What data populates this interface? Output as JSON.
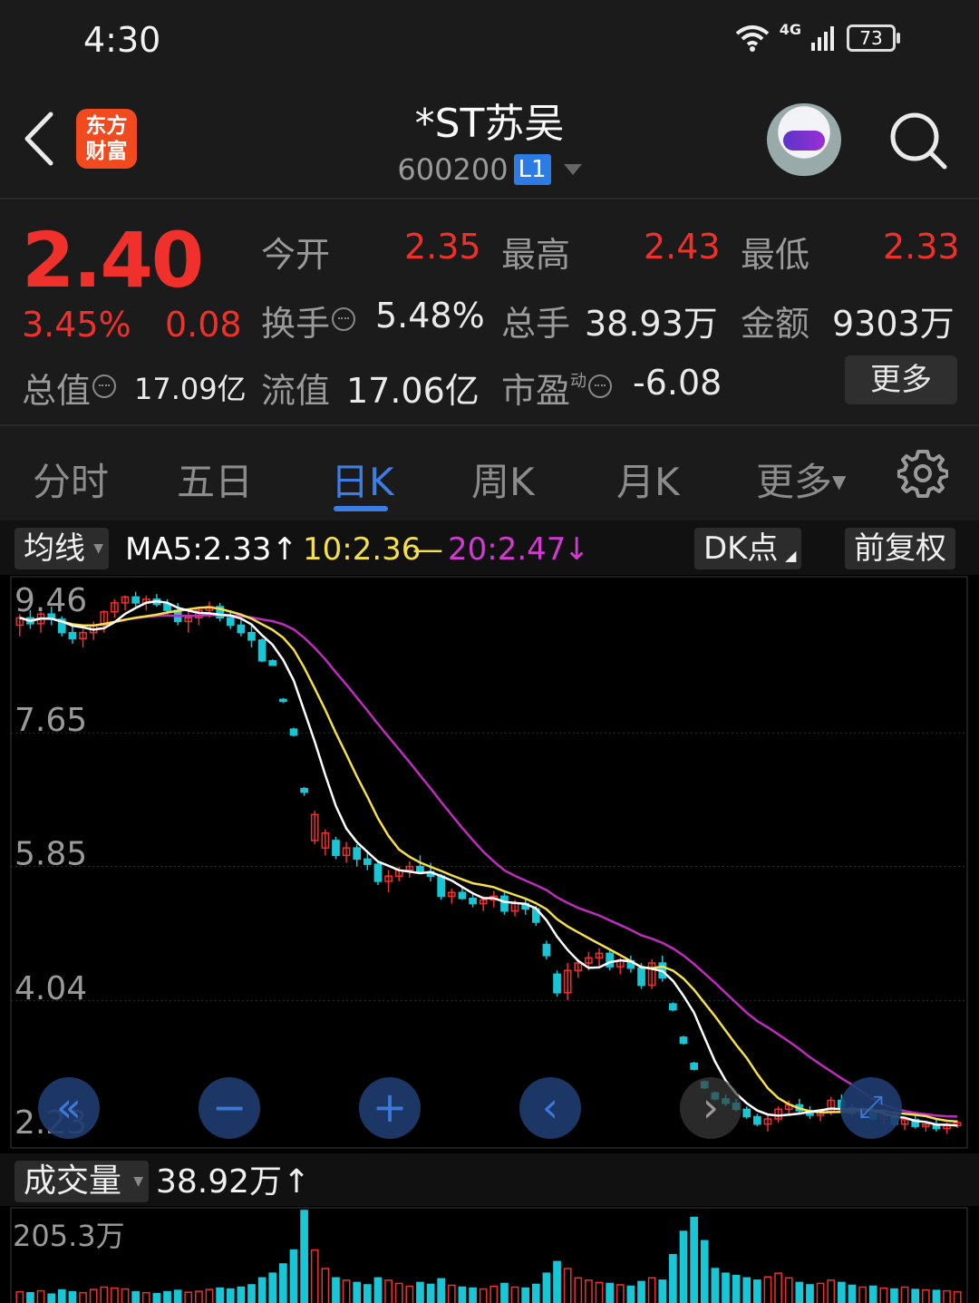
{
  "status_bar": {
    "time": "4:30",
    "network": "4G",
    "battery": "73"
  },
  "header": {
    "app_logo_line1": "东方",
    "app_logo_line2": "财富",
    "stock_name": "*ST苏吴",
    "stock_code": "600200",
    "level_badge": "L1"
  },
  "quote": {
    "price": "2.40",
    "change_pct": "3.45%",
    "change_amt": "0.08",
    "open_label": "今开",
    "open_value": "2.35",
    "high_label": "最高",
    "high_value": "2.43",
    "low_label": "最低",
    "low_value": "2.33",
    "turnover_label": "换手",
    "turnover_value": "5.48%",
    "volume_label": "总手",
    "volume_value": "38.93万",
    "amount_label": "金额",
    "amount_value": "9303万",
    "total_cap_label": "总值",
    "total_cap_value": "17.09亿",
    "float_cap_label": "流值",
    "float_cap_value": "17.06亿",
    "pe_label": "市盈",
    "pe_super": "动",
    "pe_value": "-6.08",
    "more_button": "更多"
  },
  "tabs": [
    {
      "label": "分时"
    },
    {
      "label": "五日"
    },
    {
      "label": "日K"
    },
    {
      "label": "周K"
    },
    {
      "label": "月K"
    },
    {
      "label": "更多"
    }
  ],
  "indicator_row": {
    "ma_chip": "均线",
    "ma5": "MA5:2.33",
    "ma5_arrow": "↑",
    "ma10": "10:2.36",
    "ma10_sep": "—",
    "ma20": "20:2.47",
    "ma20_arrow": "↓",
    "dk_button": "DK点",
    "adjust_button": "前复权"
  },
  "volume_row": {
    "chip": "成交量",
    "value": "38.92万",
    "arrow": "↑",
    "axis_max": "205.3万"
  },
  "colors": {
    "up": "#f0302b",
    "down": "#18c6d6",
    "ma5": "#ffffff",
    "ma10": "#f5e04a",
    "ma20": "#c22bc2",
    "accent": "#3d7ee6"
  },
  "chart_data": {
    "type": "candlestick",
    "y_tick_labels": [
      "9.46",
      "7.65",
      "5.85",
      "4.04",
      "2.23"
    ],
    "ylim": [
      2.23,
      9.46
    ],
    "ohlc": [
      [
        9.1,
        9.25,
        8.95,
        9.2
      ],
      [
        9.2,
        9.3,
        9.05,
        9.12
      ],
      [
        9.12,
        9.28,
        9.0,
        9.25
      ],
      [
        9.25,
        9.35,
        9.1,
        9.18
      ],
      [
        9.18,
        9.22,
        8.95,
        9.0
      ],
      [
        9.0,
        9.1,
        8.85,
        8.92
      ],
      [
        8.92,
        9.05,
        8.8,
        9.0
      ],
      [
        9.0,
        9.15,
        8.9,
        9.1
      ],
      [
        9.1,
        9.3,
        9.0,
        9.28
      ],
      [
        9.28,
        9.45,
        9.2,
        9.4
      ],
      [
        9.4,
        9.5,
        9.3,
        9.48
      ],
      [
        9.48,
        9.55,
        9.35,
        9.4
      ],
      [
        9.4,
        9.5,
        9.3,
        9.45
      ],
      [
        9.45,
        9.52,
        9.35,
        9.38
      ],
      [
        9.38,
        9.45,
        9.25,
        9.3
      ],
      [
        9.3,
        9.4,
        9.1,
        9.15
      ],
      [
        9.15,
        9.28,
        9.0,
        9.2
      ],
      [
        9.2,
        9.35,
        9.1,
        9.3
      ],
      [
        9.3,
        9.42,
        9.2,
        9.35
      ],
      [
        9.35,
        9.4,
        9.15,
        9.2
      ],
      [
        9.2,
        9.3,
        9.05,
        9.1
      ],
      [
        9.1,
        9.2,
        8.95,
        9.0
      ],
      [
        9.0,
        9.1,
        8.8,
        8.9
      ],
      [
        8.9,
        8.92,
        8.6,
        8.62
      ],
      [
        8.62,
        8.64,
        8.55,
        8.56
      ],
      [
        8.1,
        8.12,
        8.05,
        8.08
      ],
      [
        7.7,
        7.72,
        7.6,
        7.62
      ],
      [
        6.9,
        6.92,
        6.8,
        6.85
      ],
      [
        6.2,
        6.6,
        6.15,
        6.55
      ],
      [
        6.1,
        6.35,
        6.0,
        6.3
      ],
      [
        6.2,
        6.25,
        5.95,
        6.0
      ],
      [
        6.0,
        6.18,
        5.9,
        6.1
      ],
      [
        6.1,
        6.15,
        5.85,
        5.95
      ],
      [
        5.95,
        6.05,
        5.8,
        5.88
      ],
      [
        5.88,
        5.92,
        5.6,
        5.65
      ],
      [
        5.65,
        5.8,
        5.5,
        5.72
      ],
      [
        5.72,
        5.85,
        5.65,
        5.8
      ],
      [
        5.8,
        5.92,
        5.7,
        5.85
      ],
      [
        5.85,
        6.0,
        5.75,
        5.78
      ],
      [
        5.78,
        5.9,
        5.65,
        5.72
      ],
      [
        5.72,
        5.75,
        5.4,
        5.45
      ],
      [
        5.45,
        5.55,
        5.35,
        5.5
      ],
      [
        5.5,
        5.58,
        5.4,
        5.42
      ],
      [
        5.42,
        5.48,
        5.3,
        5.35
      ],
      [
        5.35,
        5.45,
        5.25,
        5.4
      ],
      [
        5.4,
        5.52,
        5.3,
        5.45
      ],
      [
        5.45,
        5.5,
        5.2,
        5.25
      ],
      [
        5.25,
        5.4,
        5.18,
        5.35
      ],
      [
        5.35,
        5.42,
        5.2,
        5.28
      ],
      [
        5.28,
        5.32,
        5.05,
        5.1
      ],
      [
        4.8,
        4.85,
        4.6,
        4.65
      ],
      [
        4.4,
        4.45,
        4.1,
        4.15
      ],
      [
        4.15,
        4.55,
        4.05,
        4.45
      ],
      [
        4.45,
        4.6,
        4.35,
        4.55
      ],
      [
        4.55,
        4.7,
        4.45,
        4.62
      ],
      [
        4.62,
        4.75,
        4.5,
        4.68
      ],
      [
        4.68,
        4.72,
        4.45,
        4.5
      ],
      [
        4.5,
        4.62,
        4.4,
        4.58
      ],
      [
        4.58,
        4.65,
        4.42,
        4.48
      ],
      [
        4.48,
        4.55,
        4.2,
        4.25
      ],
      [
        4.25,
        4.6,
        4.2,
        4.55
      ],
      [
        4.55,
        4.65,
        4.3,
        4.35
      ],
      [
        4.0,
        4.02,
        3.9,
        3.92
      ],
      [
        3.55,
        3.57,
        3.45,
        3.47
      ],
      [
        3.2,
        3.22,
        3.1,
        3.12
      ],
      [
        2.95,
        2.97,
        2.85,
        2.87
      ],
      [
        2.8,
        2.82,
        2.7,
        2.72
      ],
      [
        2.72,
        2.78,
        2.62,
        2.66
      ],
      [
        2.66,
        2.72,
        2.55,
        2.58
      ],
      [
        2.58,
        2.62,
        2.45,
        2.48
      ],
      [
        2.48,
        2.52,
        2.35,
        2.38
      ],
      [
        2.38,
        2.5,
        2.28,
        2.45
      ],
      [
        2.45,
        2.62,
        2.4,
        2.58
      ],
      [
        2.58,
        2.7,
        2.5,
        2.64
      ],
      [
        2.64,
        2.72,
        2.52,
        2.56
      ],
      [
        2.56,
        2.62,
        2.45,
        2.5
      ],
      [
        2.5,
        2.58,
        2.42,
        2.55
      ],
      [
        2.55,
        2.75,
        2.5,
        2.7
      ],
      [
        2.7,
        2.78,
        2.55,
        2.6
      ],
      [
        2.6,
        2.66,
        2.48,
        2.52
      ],
      [
        2.52,
        2.6,
        2.44,
        2.56
      ],
      [
        2.56,
        2.62,
        2.42,
        2.45
      ],
      [
        2.45,
        2.55,
        2.38,
        2.5
      ],
      [
        2.5,
        2.56,
        2.35,
        2.38
      ],
      [
        2.38,
        2.48,
        2.3,
        2.44
      ],
      [
        2.44,
        2.5,
        2.32,
        2.35
      ],
      [
        2.35,
        2.42,
        2.28,
        2.38
      ],
      [
        2.38,
        2.44,
        2.28,
        2.32
      ],
      [
        2.32,
        2.4,
        2.25,
        2.36
      ],
      [
        2.36,
        2.43,
        2.33,
        2.4
      ]
    ],
    "ma5_last": 2.33,
    "ma10_last": 2.36,
    "ma20_last": 2.47,
    "volume_axis_max": "205.3万",
    "volumes": [
      30,
      28,
      32,
      25,
      34,
      30,
      28,
      35,
      40,
      38,
      36,
      30,
      28,
      26,
      30,
      33,
      29,
      31,
      35,
      38,
      36,
      40,
      45,
      60,
      70,
      90,
      120,
      205,
      120,
      80,
      60,
      55,
      50,
      45,
      60,
      55,
      48,
      42,
      50,
      46,
      58,
      44,
      40,
      38,
      36,
      42,
      48,
      40,
      38,
      46,
      70,
      95,
      80,
      60,
      55,
      50,
      48,
      45,
      42,
      52,
      60,
      55,
      110,
      160,
      190,
      140,
      80,
      70,
      65,
      60,
      55,
      62,
      70,
      60,
      50,
      45,
      48,
      55,
      50,
      44,
      40,
      42,
      38,
      36,
      40,
      35,
      34,
      33,
      32,
      30
    ]
  }
}
